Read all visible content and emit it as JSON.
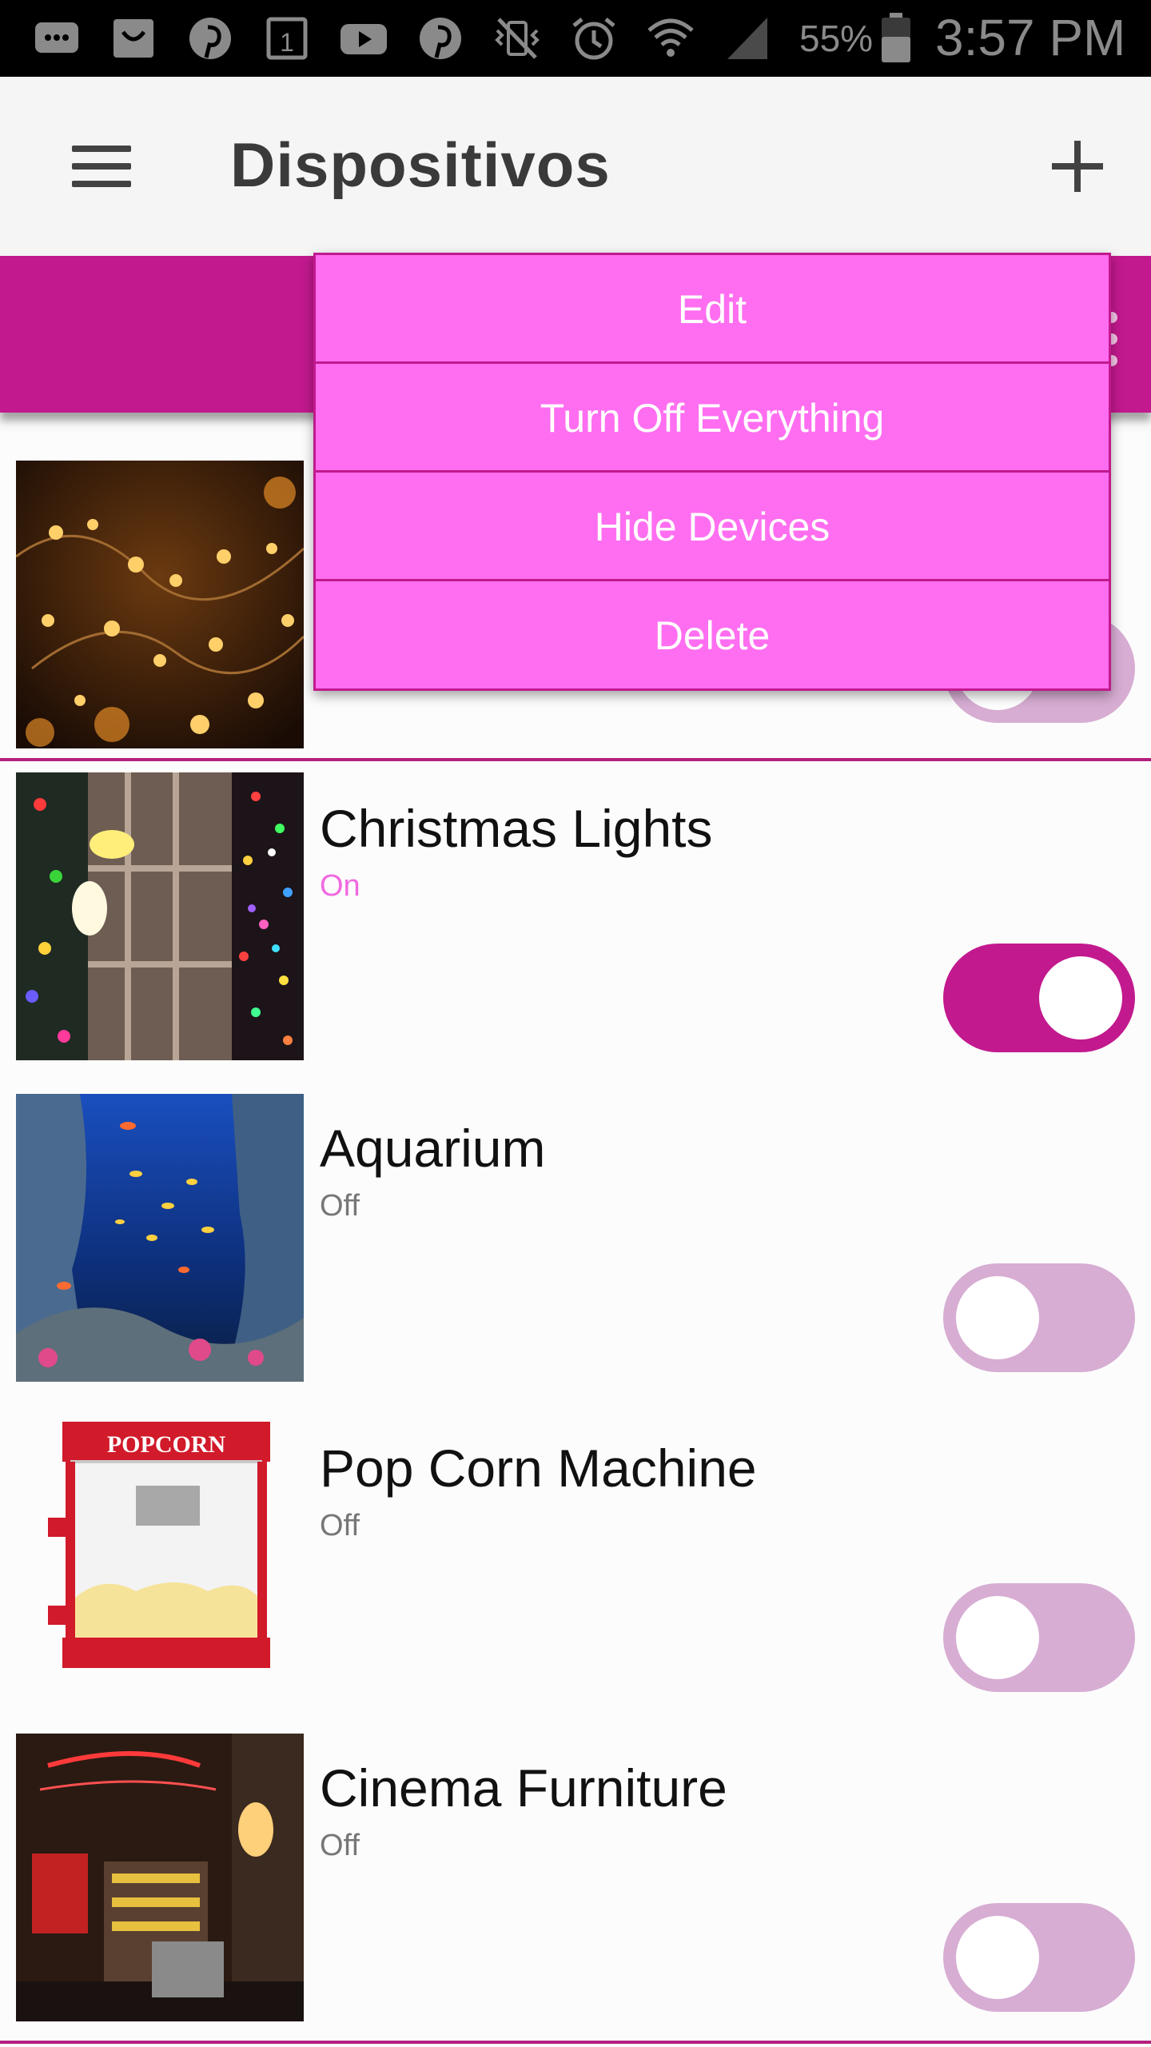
{
  "status_bar": {
    "icons": [
      "chat-icon",
      "shopping-bag-icon",
      "pinterest-icon",
      "calendar-icon",
      "youtube-icon",
      "pinterest-icon",
      "vibrate-mute-icon",
      "alarm-icon",
      "wifi-icon",
      "signal-icon"
    ],
    "battery_percent": "55%",
    "time": "3:57 PM"
  },
  "app_bar": {
    "title": "Dispositivos"
  },
  "popup_menu": {
    "items": [
      "Edit",
      "Turn Off Everything",
      "Hide Devices",
      "Delete"
    ]
  },
  "devices": [
    {
      "name": "",
      "status": "",
      "on": false,
      "image": "string-lights-photo"
    },
    {
      "name": "Christmas Lights",
      "status": "On",
      "on": true,
      "image": "christmas-lights-photo"
    },
    {
      "name": "Aquarium",
      "status": "Off",
      "on": false,
      "image": "aquarium-photo"
    },
    {
      "name": "Pop Corn Machine",
      "status": "Off",
      "on": false,
      "image": "popcorn-machine-photo",
      "image_text": "POPCORN"
    },
    {
      "name": "Cinema Furniture",
      "status": "Off",
      "on": false,
      "image": "cinema-photo"
    }
  ],
  "colors": {
    "accent": "#c2198e",
    "menu_background": "#ff6ef0",
    "toggle_off": "#d7add3",
    "status_on": "#f06ae0"
  }
}
